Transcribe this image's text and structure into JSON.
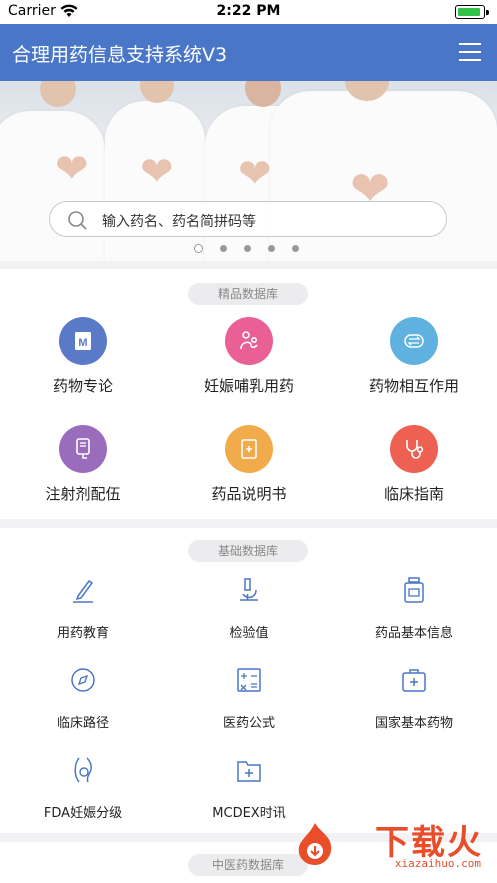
{
  "status_bar": {
    "carrier": "Carrier",
    "time": "2:22 PM"
  },
  "header": {
    "title": "合理用药信息支持系统V3"
  },
  "search": {
    "placeholder": "输入药名、药名简拼码等"
  },
  "carousel": {
    "pages": 5,
    "active": 1
  },
  "sections": {
    "premium": {
      "title": "精品数据库",
      "items": [
        {
          "label": "药物专论",
          "icon": "m-document-icon",
          "color": "#5a79c6"
        },
        {
          "label": "妊娠哺乳用药",
          "icon": "mother-baby-icon",
          "color": "#ea5f95"
        },
        {
          "label": "药物相互作用",
          "icon": "interaction-arrows-icon",
          "color": "#5fb1e0"
        },
        {
          "label": "注射剂配伍",
          "icon": "infusion-bag-icon",
          "color": "#9a6cbc"
        },
        {
          "label": "药品说明书",
          "icon": "leaflet-icon",
          "color": "#f1ab4a"
        },
        {
          "label": "临床指南",
          "icon": "stethoscope-icon",
          "color": "#ee6052"
        }
      ]
    },
    "basic": {
      "title": "基础数据库",
      "items": [
        {
          "label": "用药教育",
          "icon": "pen-icon"
        },
        {
          "label": "检验值",
          "icon": "microscope-icon"
        },
        {
          "label": "药品基本信息",
          "icon": "medicine-bottle-icon"
        },
        {
          "label": "临床路径",
          "icon": "compass-icon"
        },
        {
          "label": "医药公式",
          "icon": "calculator-icon"
        },
        {
          "label": "国家基本药物",
          "icon": "medical-kit-icon"
        },
        {
          "label": "FDA妊娠分级",
          "icon": "pregnancy-icon"
        },
        {
          "label": "MCDEX时讯",
          "icon": "folder-plus-icon"
        }
      ]
    },
    "tcm": {
      "title": "中医药数据库"
    }
  },
  "watermark": {
    "text": "下载火",
    "url": "xiazaihuo.com"
  }
}
